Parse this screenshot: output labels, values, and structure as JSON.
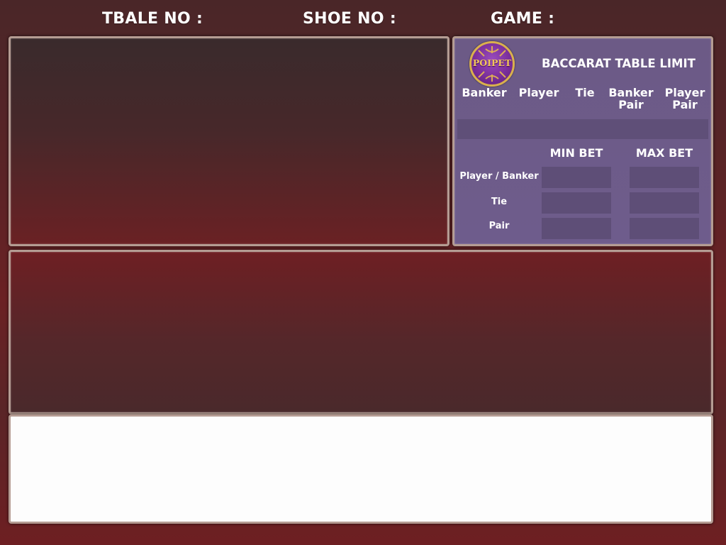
{
  "header": {
    "table_label": "TBALE NO :",
    "shoe_label": "SHOE NO :",
    "game_label": "GAME  :"
  },
  "logo": {
    "text": "POIPET",
    "icon": "poipet-casino-logo-icon"
  },
  "limits": {
    "title": "BACCARAT TABLE LIMIT",
    "bet_types": [
      "Banker",
      "Player",
      "Tie",
      "Banker\nPair",
      "Player\nPair"
    ],
    "columns": {
      "min": "MIN BET",
      "max": "MAX BET"
    },
    "rows": [
      {
        "label": "Player / Banker",
        "min": "",
        "max": ""
      },
      {
        "label": "Tie",
        "min": "",
        "max": ""
      },
      {
        "label": "Pair",
        "min": "",
        "max": ""
      }
    ]
  },
  "colors": {
    "background": "#5c2326",
    "limit_panel": "#6c5a86",
    "frame_border": "#b59c93",
    "info_panel": "#fdfdfd",
    "logo_gold": "#d9b04d",
    "logo_purple": "#7a2f9b"
  }
}
